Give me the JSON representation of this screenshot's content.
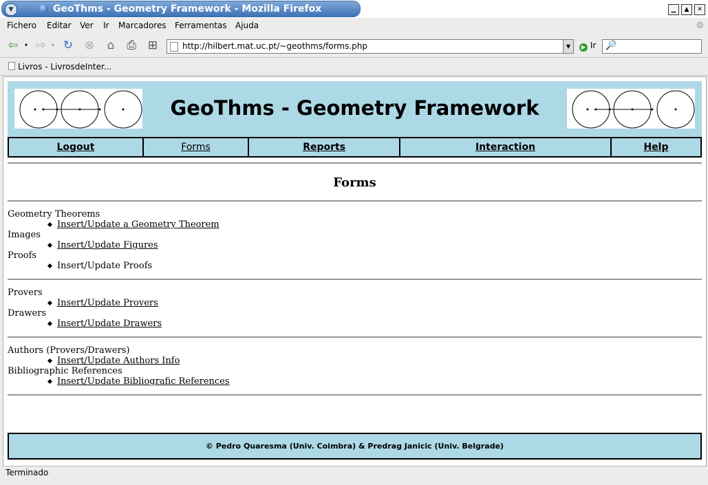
{
  "window": {
    "title": "GeoThms - Geometry Framework - Mozilla Firefox"
  },
  "menu": [
    "Fichero",
    "Editar",
    "Ver",
    "Ir",
    "Marcadores",
    "Ferramentas",
    "Ajuda"
  ],
  "toolbar": {
    "url": "http://hilbert.mat.uc.pt/~geothms/forms.php",
    "go_label": "Ir",
    "search_value": ""
  },
  "bookmarks": [
    "Livros - LivrosdeInter..."
  ],
  "site": {
    "title": "GeoThms - Geometry Framework",
    "nav": [
      "Logout",
      "Forms",
      "Reports",
      "Interaction",
      "Help"
    ],
    "current_nav": "Forms",
    "page_heading": "Forms",
    "sections": [
      {
        "groups": [
          {
            "category": "Geometry Theorems",
            "items": [
              {
                "label": "Insert/Update a Geometry Theorem",
                "link": true
              }
            ]
          },
          {
            "category": "Images",
            "items": [
              {
                "label": "Insert/Update Figures",
                "link": true
              }
            ]
          },
          {
            "category": "Proofs",
            "items": [
              {
                "label": "Insert/Update Proofs",
                "link": false
              }
            ]
          }
        ]
      },
      {
        "groups": [
          {
            "category": "Provers",
            "items": [
              {
                "label": "Insert/Update Provers",
                "link": true
              }
            ]
          },
          {
            "category": "Drawers",
            "items": [
              {
                "label": "Insert/Update Drawers",
                "link": true
              }
            ]
          }
        ]
      },
      {
        "groups": [
          {
            "category": "Authors (Provers/Drawers)",
            "items": [
              {
                "label": "Insert/Update Authors Info",
                "link": true
              }
            ]
          },
          {
            "category": "Bibliographic References",
            "items": [
              {
                "label": "Insert/Update Bibliografic References",
                "link": true
              }
            ]
          }
        ]
      }
    ],
    "footer": "© Pedro Quaresma (Univ. Coimbra) & Predrag Janicic (Univ. Belgrade)"
  },
  "status": {
    "text": "Terminado"
  }
}
